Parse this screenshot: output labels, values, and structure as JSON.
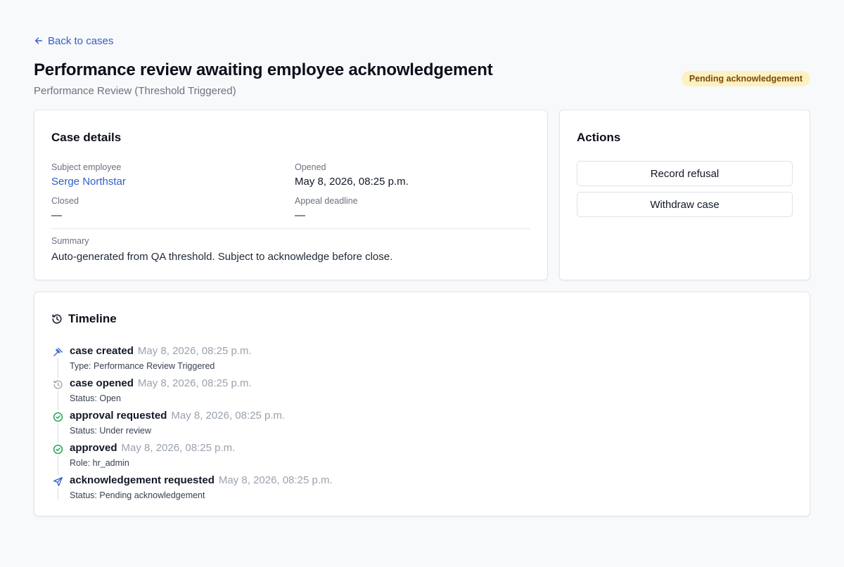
{
  "nav": {
    "back_label": "Back to cases"
  },
  "header": {
    "title": "Performance review awaiting employee acknowledgement",
    "subtitle": "Performance Review (Threshold Triggered)",
    "status": "Pending acknowledgement"
  },
  "colors": {
    "accent": "#2f5fc9",
    "badge_bg": "#fdf1c4",
    "badge_text": "#7a4b06",
    "success": "#16a34a",
    "muted": "#9aa2ae"
  },
  "details": {
    "title": "Case details",
    "subject_label": "Subject employee",
    "subject_value": "Serge Northstar",
    "opened_label": "Opened",
    "opened_value": "May 8, 2026, 08:25 p.m.",
    "closed_label": "Closed",
    "closed_value": "—",
    "appeal_label": "Appeal deadline",
    "appeal_value": "—",
    "summary_label": "Summary",
    "summary_value": "Auto-generated from QA threshold. Subject to acknowledge before close."
  },
  "actions": {
    "title": "Actions",
    "buttons": [
      "Record refusal",
      "Withdraw case"
    ]
  },
  "timeline": {
    "title": "Timeline",
    "title_icon": "history-icon",
    "items": [
      {
        "event": "case created",
        "time": "May 8, 2026, 08:25 p.m.",
        "detail": "Type: Performance Review Triggered",
        "icon": "gavel-icon"
      },
      {
        "event": "case opened",
        "time": "May 8, 2026, 08:25 p.m.",
        "detail": "Status: Open",
        "icon": "history-icon"
      },
      {
        "event": "approval requested",
        "time": "May 8, 2026, 08:25 p.m.",
        "detail": "Status: Under review",
        "icon": "check-circle-icon"
      },
      {
        "event": "approved",
        "time": "May 8, 2026, 08:25 p.m.",
        "detail": "Role: hr_admin",
        "icon": "check-circle-icon"
      },
      {
        "event": "acknowledgement requested",
        "time": "May 8, 2026, 08:25 p.m.",
        "detail": "Status: Pending acknowledgement",
        "icon": "send-icon"
      }
    ]
  }
}
